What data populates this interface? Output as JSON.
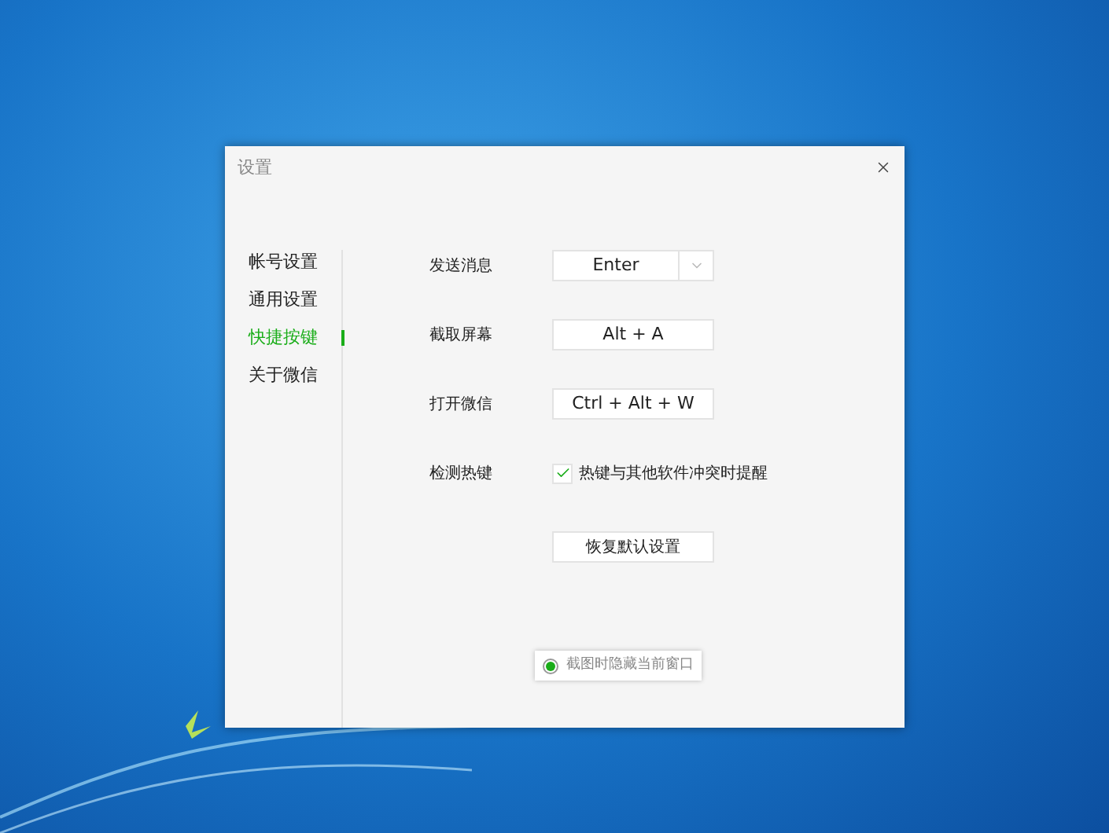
{
  "window": {
    "title": "设置"
  },
  "sidebar": {
    "items": [
      {
        "label": "帐号设置",
        "selected": false
      },
      {
        "label": "通用设置",
        "selected": false
      },
      {
        "label": "快捷按键",
        "selected": true
      },
      {
        "label": "关于微信",
        "selected": false
      }
    ]
  },
  "settings": [
    {
      "kind": "dropdown",
      "label": "发送消息",
      "value": "Enter"
    },
    {
      "kind": "key",
      "label": "截取屏幕",
      "value": "Alt + A"
    },
    {
      "kind": "key",
      "label": "打开微信",
      "value": "Ctrl + Alt + W"
    },
    {
      "kind": "checkbox",
      "label": "检测热键",
      "text": "热键与其他软件冲突时提醒",
      "checked": true
    }
  ],
  "reset_button": "恢复默认设置",
  "floating_option": {
    "label": "截图时隐藏当前窗口",
    "selected": true
  }
}
